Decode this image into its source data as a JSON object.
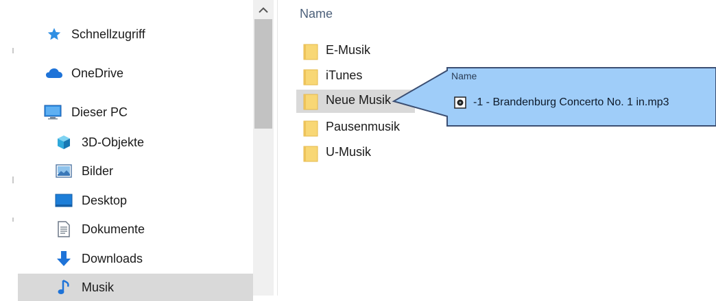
{
  "nav": {
    "items": [
      {
        "label": "Schnellzugriff",
        "icon": "star-icon"
      },
      {
        "label": "OneDrive",
        "icon": "cloud-icon"
      },
      {
        "label": "Dieser PC",
        "icon": "computer-icon"
      },
      {
        "label": "3D-Objekte",
        "icon": "cube-icon"
      },
      {
        "label": "Bilder",
        "icon": "pictures-icon"
      },
      {
        "label": "Desktop",
        "icon": "desktop-icon"
      },
      {
        "label": "Dokumente",
        "icon": "document-icon"
      },
      {
        "label": "Downloads",
        "icon": "download-arrow-icon"
      },
      {
        "label": "Musik",
        "icon": "music-note-icon",
        "selected": true
      }
    ]
  },
  "content": {
    "header": "Name",
    "folders": [
      {
        "label": "E-Musik"
      },
      {
        "label": "iTunes"
      },
      {
        "label": "Neue Musik",
        "selected": true
      },
      {
        "label": "Pausenmusik"
      },
      {
        "label": "U-Musik"
      }
    ]
  },
  "popup": {
    "header": "Name",
    "file": "-1 - Brandenburg Concerto No. 1 in.mp3",
    "file_icon": "audio-file-icon"
  },
  "colors": {
    "selection": "#d9d9d9",
    "callout_fill": "#9fcdf9",
    "callout_border": "#3b4e72",
    "folder": "#f8d775",
    "accent_blue": "#1e73d8"
  }
}
